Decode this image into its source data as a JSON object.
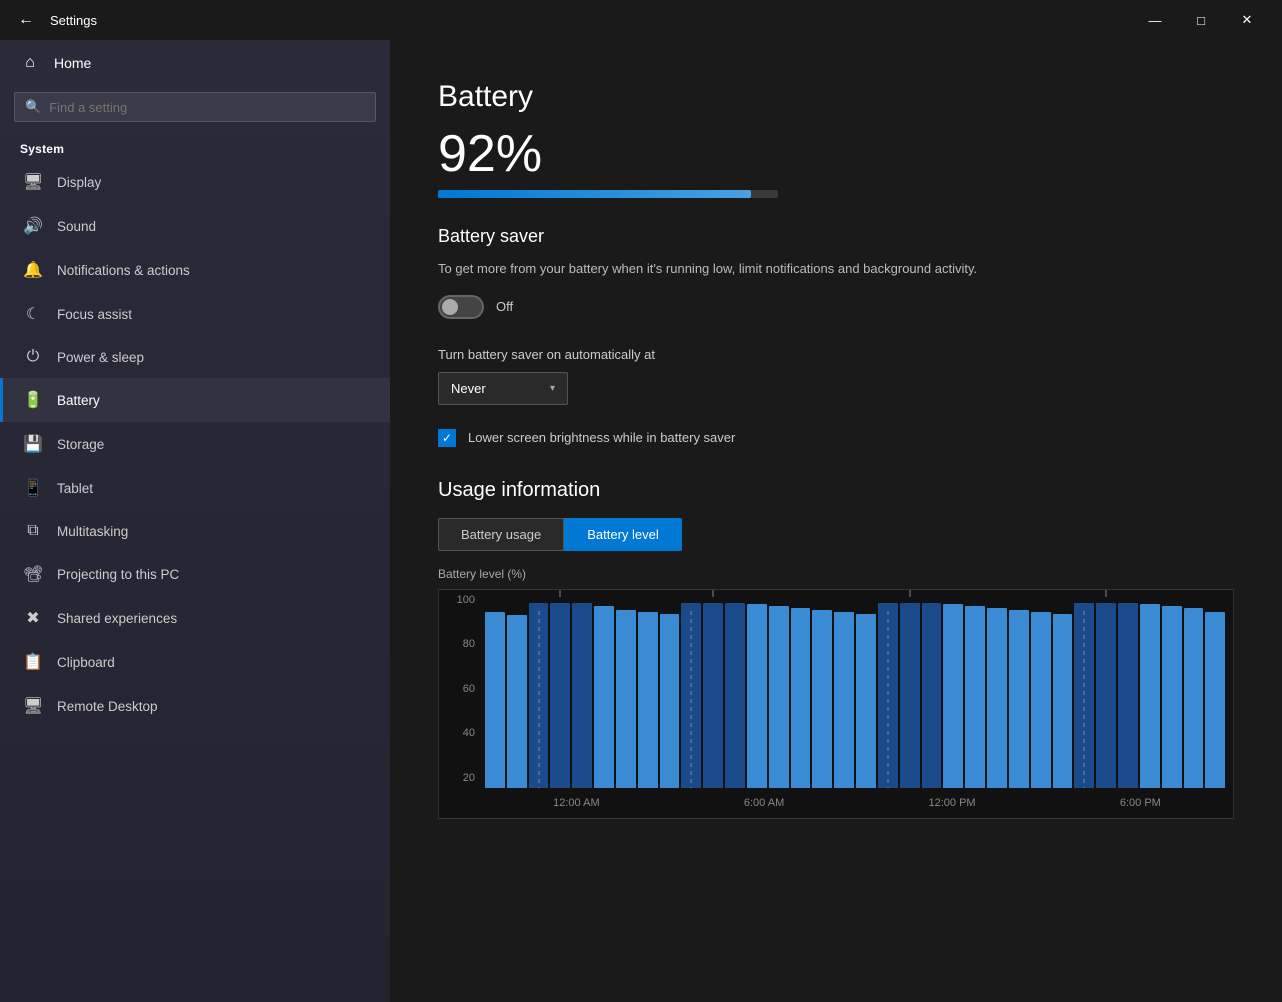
{
  "titlebar": {
    "back_icon": "←",
    "title": "Settings",
    "minimize_icon": "—",
    "maximize_icon": "□",
    "close_icon": "✕"
  },
  "sidebar": {
    "home_label": "Home",
    "search_placeholder": "Find a setting",
    "section_label": "System",
    "items": [
      {
        "id": "display",
        "icon": "▭",
        "label": "Display"
      },
      {
        "id": "sound",
        "icon": "🔊",
        "label": "Sound"
      },
      {
        "id": "notifications",
        "icon": "🔔",
        "label": "Notifications & actions"
      },
      {
        "id": "focus",
        "icon": "☾",
        "label": "Focus assist"
      },
      {
        "id": "power",
        "icon": "⏻",
        "label": "Power & sleep"
      },
      {
        "id": "battery",
        "icon": "▭",
        "label": "Battery",
        "active": true
      },
      {
        "id": "storage",
        "icon": "▭",
        "label": "Storage"
      },
      {
        "id": "tablet",
        "icon": "▭",
        "label": "Tablet"
      },
      {
        "id": "multitasking",
        "icon": "▭",
        "label": "Multitasking"
      },
      {
        "id": "projecting",
        "icon": "▭",
        "label": "Projecting to this PC"
      },
      {
        "id": "shared",
        "icon": "✕",
        "label": "Shared experiences"
      },
      {
        "id": "clipboard",
        "icon": "▭",
        "label": "Clipboard"
      },
      {
        "id": "remote",
        "icon": "▭",
        "label": "Remote Desktop"
      }
    ]
  },
  "content": {
    "page_title": "Battery",
    "battery_percent": "92%",
    "battery_fill_width": "92%",
    "section_battery_saver": "Battery saver",
    "battery_saver_desc": "To get more from your battery when it's running low, limit notifications and background activity.",
    "toggle_state": "Off",
    "auto_label": "Turn battery saver on automatically at",
    "dropdown_value": "Never",
    "checkbox_label": "Lower screen brightness while in battery saver",
    "usage_title": "Usage information",
    "chart_y_label": "Battery level (%)",
    "tab_usage": "Battery usage",
    "tab_level": "Battery level",
    "chart_y_values": [
      "100",
      "80",
      "60",
      "40",
      "20"
    ],
    "chart_x_labels": [
      "12:00 AM",
      "6:00 AM",
      "12:00 PM",
      "6:00 PM"
    ]
  }
}
